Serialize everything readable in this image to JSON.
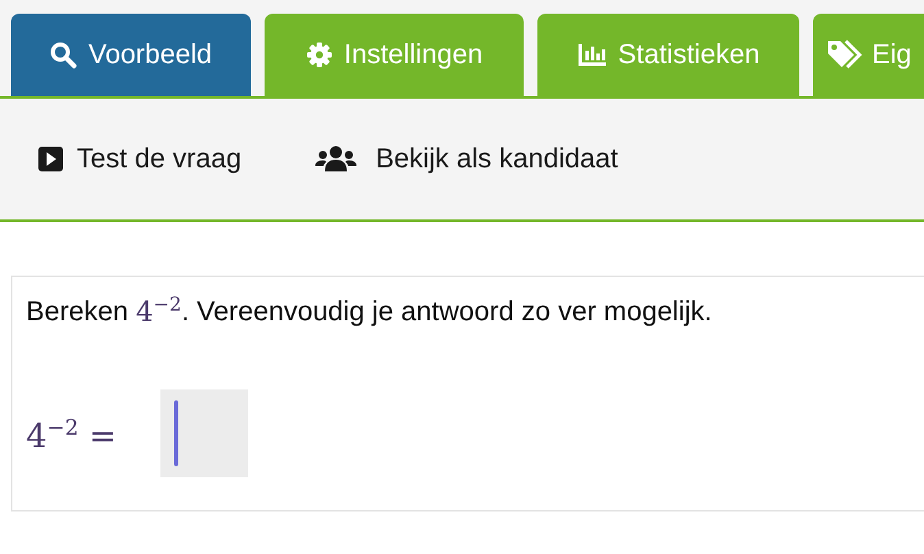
{
  "tabs": [
    {
      "label": "Voorbeeld",
      "selected": true
    },
    {
      "label": "Instellingen",
      "selected": false
    },
    {
      "label": "Statistieken",
      "selected": false
    },
    {
      "label": "Eig",
      "selected": false
    }
  ],
  "toolbar": [
    {
      "label": "Test de vraag"
    },
    {
      "label": "Bekijk als kandidaat"
    }
  ],
  "question": {
    "before": "Bereken ",
    "math_base": "4",
    "math_exponent": "−2",
    "after": ". Vereenvoudig je antwoord zo ver mogelijk.",
    "answer": {
      "base": "4",
      "exponent": "−2",
      "relation": "=",
      "focused": true
    }
  }
}
